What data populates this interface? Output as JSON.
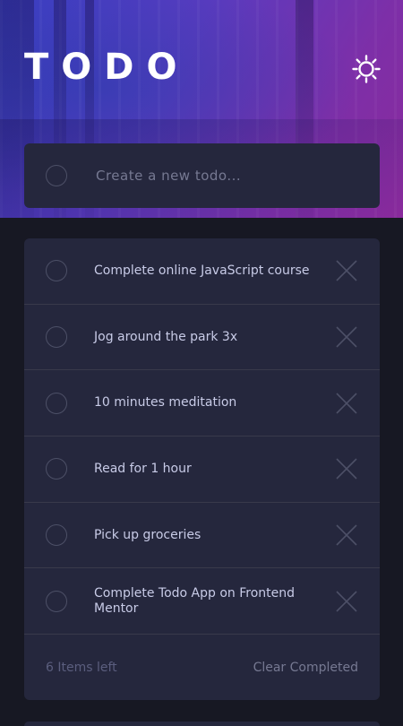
{
  "app": {
    "title": "TODO"
  },
  "new_todo": {
    "placeholder": "Create a new todo..."
  },
  "todos": [
    {
      "text": "Complete online JavaScript course",
      "completed": false
    },
    {
      "text": "Jog around the park 3x",
      "completed": false
    },
    {
      "text": "10 minutes meditation",
      "completed": false
    },
    {
      "text": "Read for 1 hour",
      "completed": false
    },
    {
      "text": "Pick up groceries",
      "completed": false
    },
    {
      "text": "Complete Todo App on Frontend Mentor",
      "completed": false
    }
  ],
  "footer": {
    "items_left": "6 Items left",
    "clear_label": "Clear Completed"
  },
  "icons": {
    "theme_toggle": "sun-icon",
    "delete": "close-icon",
    "check": "circle-icon"
  },
  "colors": {
    "card": "#25273d",
    "background": "#171823",
    "text": "#c8cbe7",
    "muted": "#767992",
    "hero_start": "#3a3fc4",
    "hero_end": "#8a2a9c"
  }
}
